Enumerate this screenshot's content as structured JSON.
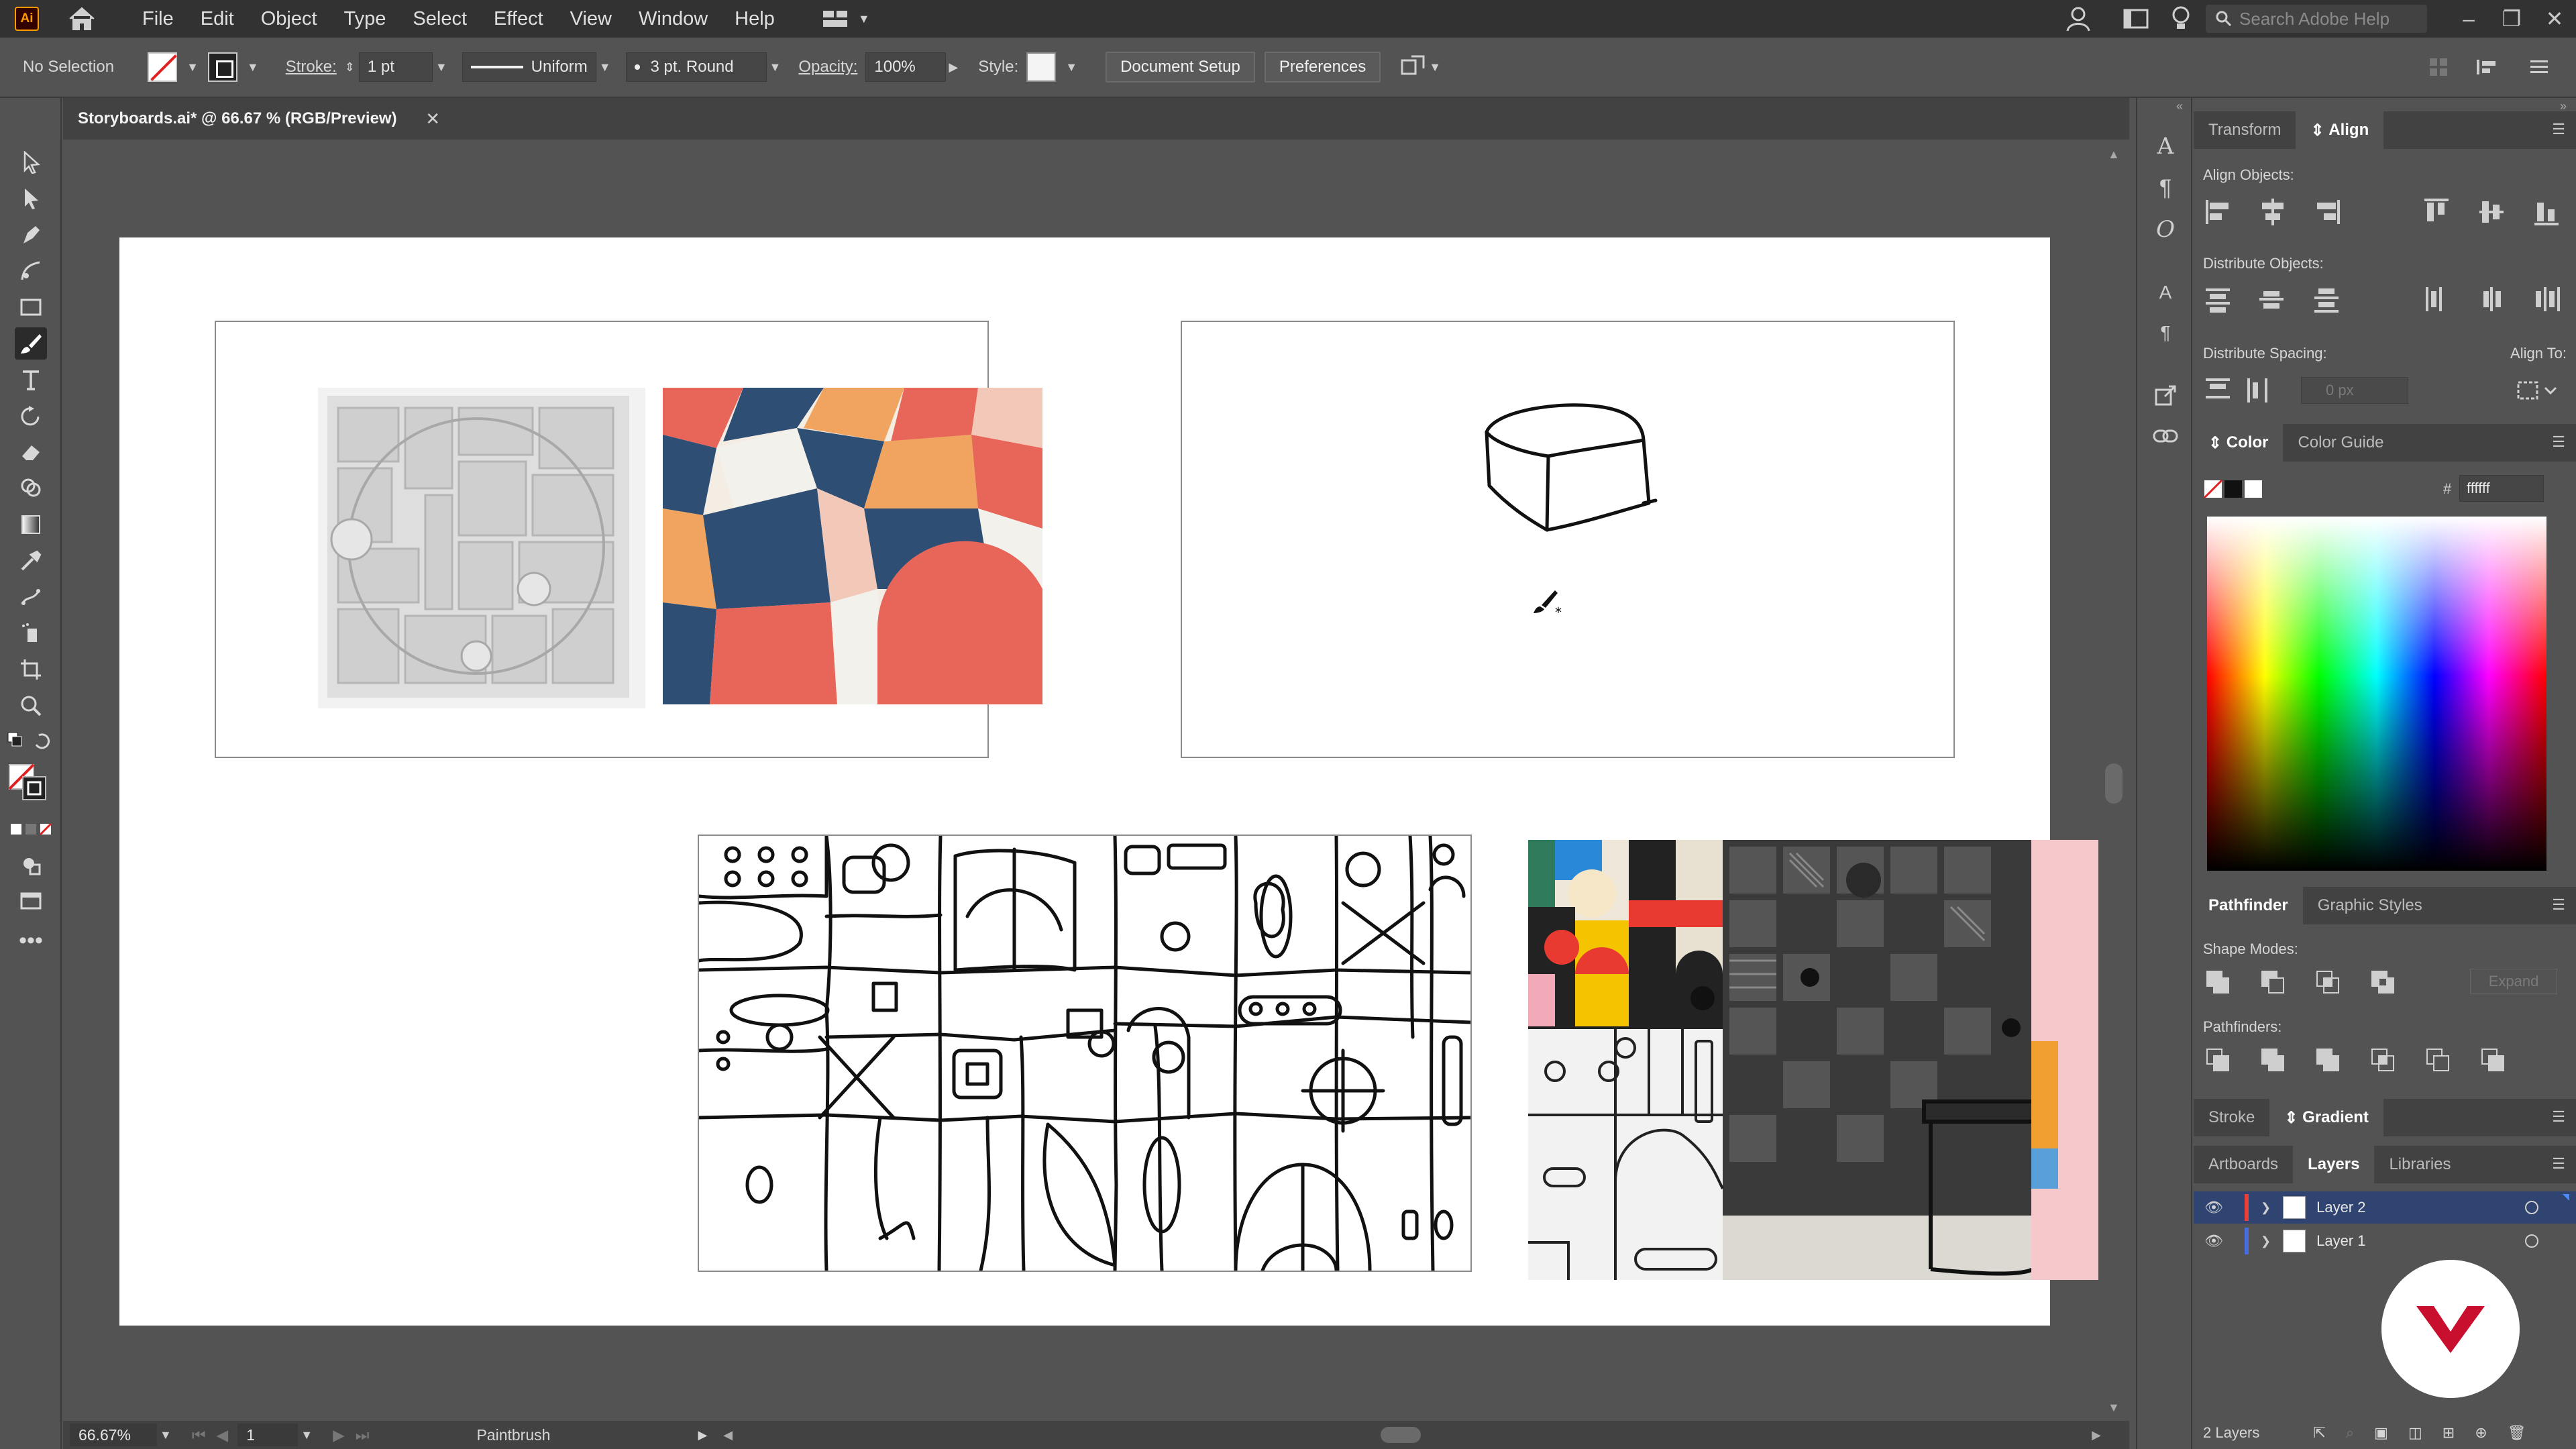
{
  "app": {
    "logo": "Ai",
    "search_placeholder": "Search Adobe Help"
  },
  "menu": [
    "File",
    "Edit",
    "Object",
    "Type",
    "Select",
    "Effect",
    "View",
    "Window",
    "Help"
  ],
  "control_bar": {
    "selection": "No Selection",
    "stroke_label": "Stroke:",
    "stroke_weight": "1 pt",
    "profile": "Uniform",
    "brush": "3 pt. Round",
    "opacity_label": "Opacity:",
    "opacity": "100%",
    "style_label": "Style:",
    "document_setup": "Document Setup",
    "preferences": "Preferences"
  },
  "document": {
    "tab_title": "Storyboards.ai* @ 66.67 % (RGB/Preview)"
  },
  "status": {
    "zoom": "66.67%",
    "artboard": "1",
    "tool": "Paintbrush"
  },
  "panels": {
    "top_tabs": [
      "Transform",
      "Align"
    ],
    "align": {
      "align_objects": "Align Objects:",
      "distribute_objects": "Distribute Objects:",
      "distribute_spacing": "Distribute Spacing:",
      "align_to": "Align To:",
      "spacing_value": "0 px"
    },
    "color_tabs": [
      "Color",
      "Color Guide"
    ],
    "color": {
      "hash": "#",
      "hex": "ffffff"
    },
    "pathfinder_tabs": [
      "Pathfinder",
      "Graphic Styles"
    ],
    "pathfinder": {
      "shape_modes": "Shape Modes:",
      "pathfinders": "Pathfinders:",
      "expand": "Expand"
    },
    "stroke_tabs": [
      "Stroke",
      "Gradient"
    ],
    "layer_tabs": [
      "Artboards",
      "Layers",
      "Libraries"
    ],
    "layers": [
      {
        "name": "Layer 2",
        "color": "#e8403a"
      },
      {
        "name": "Layer 1",
        "color": "#4a6ee0"
      }
    ],
    "layer_count": "2 Layers"
  },
  "colors": {
    "accent_selected_row": "#2f4470",
    "brand_logo": "#c8102e"
  }
}
